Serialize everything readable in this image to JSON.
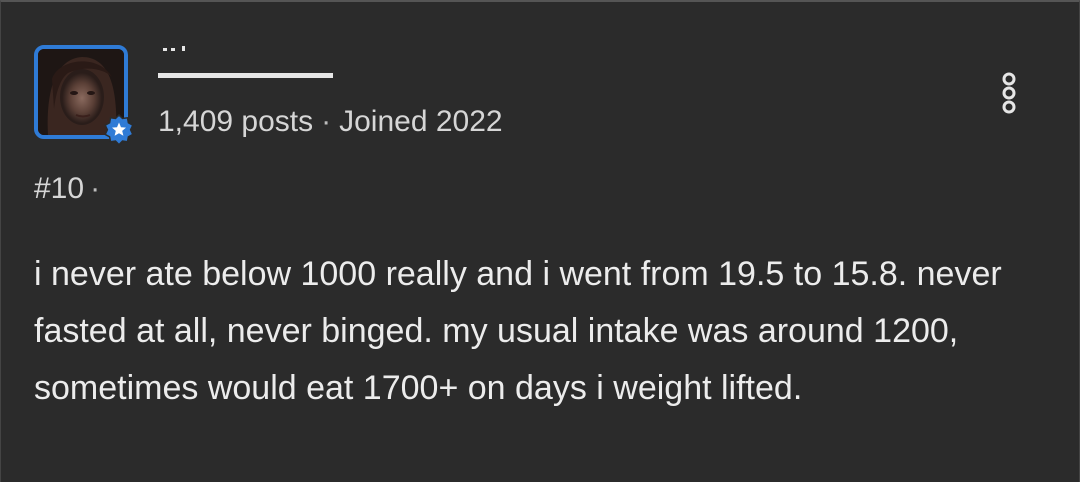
{
  "post": {
    "author": {
      "post_count": "1,409 posts",
      "separator": "·",
      "joined": "Joined 2022",
      "badge_icon": "star-badge-icon"
    },
    "number": "#10",
    "number_separator": "·",
    "body": "i never ate below 1000 really and i went from 19.5 to 15.8. never fasted at all, never binged. my usual intake was around 1200, sometimes would eat 1700+ on days i weight lifted.",
    "menu_icon": "vertical-ellipsis-icon"
  },
  "colors": {
    "background": "#2b2b2b",
    "avatar_border": "#2f7bd6",
    "text": "#ececec",
    "muted_text": "#d6d6d6"
  }
}
